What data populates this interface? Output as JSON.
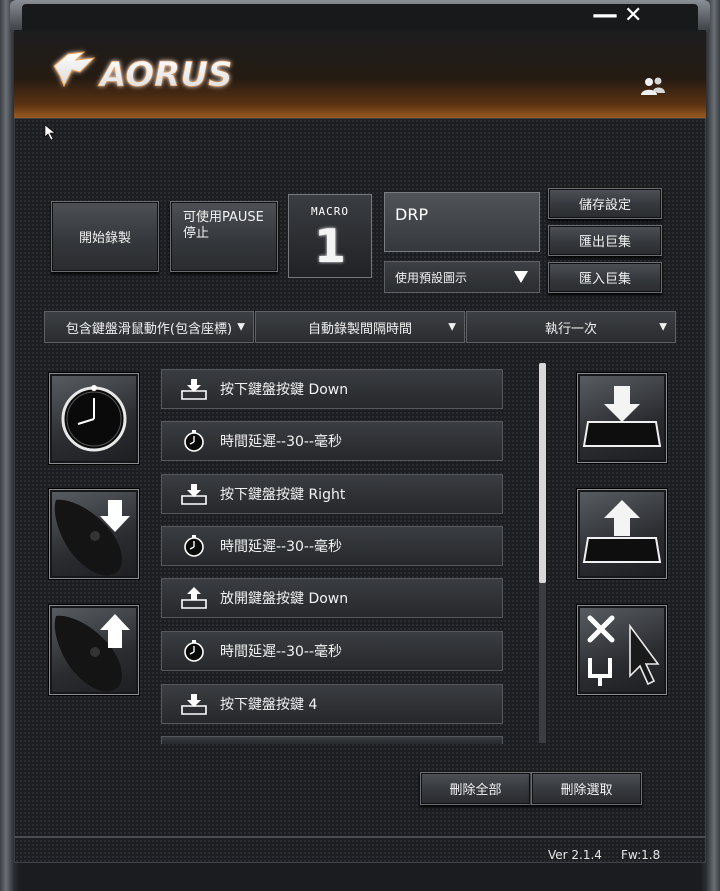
{
  "window": {
    "minimize_glyph": "—",
    "close_glyph": "✕",
    "brand": "AORUS"
  },
  "toolbar": {
    "start_record_label": "開始錄製",
    "pause_label": "可使用PAUSE\n停止",
    "macro_label": "MACRO",
    "macro_number": "1",
    "macro_name_value": "DRP",
    "icon_select_label": "使用預設圖示",
    "save_settings_label": "儲存設定",
    "export_macro_label": "匯出巨集",
    "import_macro_label": "匯入巨集"
  },
  "options": {
    "record_mode": "包含鍵盤滑鼠動作(包含座標)",
    "delay_mode": "自動錄製間隔時間",
    "run_mode": "執行一次"
  },
  "macro_list": [
    {
      "icon": "key-down-icon",
      "text": "按下鍵盤按鍵 Down"
    },
    {
      "icon": "timer-icon",
      "text": "時間延遲--30--毫秒"
    },
    {
      "icon": "key-down-icon",
      "text": "按下鍵盤按鍵 Right"
    },
    {
      "icon": "timer-icon",
      "text": "時間延遲--30--毫秒"
    },
    {
      "icon": "key-up-icon",
      "text": "放開鍵盤按鍵 Down"
    },
    {
      "icon": "timer-icon",
      "text": "時間延遲--30--毫秒"
    },
    {
      "icon": "key-down-icon",
      "text": "按下鍵盤按鍵 4"
    }
  ],
  "actions": {
    "delete_all_label": "刪除全部",
    "delete_selected_label": "刪除選取"
  },
  "status": {
    "version_text": "Ver 2.1.4     Fw:1.8"
  },
  "colors": {
    "accent": "#c9823c",
    "background": "#1c1e21"
  }
}
